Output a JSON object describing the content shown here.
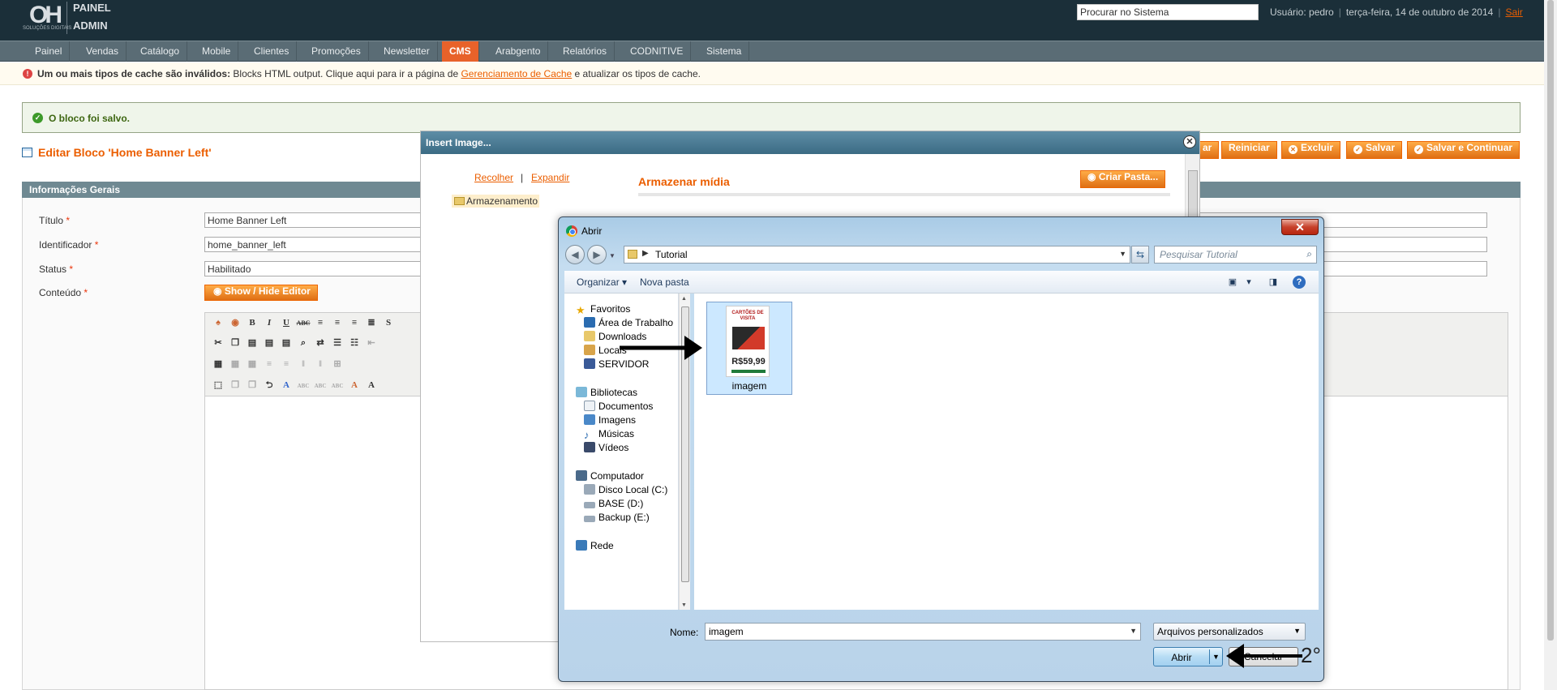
{
  "header": {
    "logo_mark": "OH",
    "logo_tagline": "SOLUÇÕES DIGITAIS",
    "logo_line1": "PAINEL",
    "logo_line2": "ADMIN",
    "search_placeholder": "Procurar no Sistema",
    "user": "Usuário: pedro",
    "date": "terça-feira, 14 de outubro de 2014",
    "logout": "Sair"
  },
  "nav": {
    "items": [
      "Painel",
      "Vendas",
      "Catálogo",
      "Mobile",
      "Clientes",
      "Promoções",
      "Newsletter",
      "CMS",
      "Arabgento",
      "Relatórios",
      "CODNITIVE",
      "Sistema"
    ],
    "active": "CMS"
  },
  "notices": {
    "cache_bold": "Um ou mais tipos de cache são inválidos:",
    "cache_text": " Blocks HTML output. Clique aqui para ir a página de ",
    "cache_link": "Gerenciamento de Cache",
    "cache_tail": " e atualizar os tipos de cache.",
    "success": "O bloco foi salvo."
  },
  "page": {
    "title": "Editar Bloco 'Home Banner Left'",
    "buttons": {
      "back": "ar",
      "reset": "Reiniciar",
      "delete": "Excluir",
      "save": "Salvar",
      "save_continue": "Salvar e Continuar"
    }
  },
  "form": {
    "section_title": "Informações Gerais",
    "title_label": "Título",
    "title_value": "Home Banner Left",
    "identifier_label": "Identificador",
    "identifier_value": "home_banner_left",
    "status_label": "Status",
    "status_value": "Habilitado",
    "content_label": "Conteúdo",
    "required_mark": "*",
    "toggle_editor": "Show / Hide Editor",
    "toolbar_partial": "S"
  },
  "insert_image": {
    "title": "Insert Image...",
    "collapse": "Recolher",
    "separator": "|",
    "expand": "Expandir",
    "tree_root": "Armazenamento",
    "media_title": "Armazenar mídia",
    "new_folder": "Criar Pasta..."
  },
  "open_dialog": {
    "title": "Abrir",
    "address": "Tutorial",
    "search_placeholder": "Pesquisar Tutorial",
    "organize": "Organizar",
    "new_folder": "Nova pasta",
    "nav_tree": [
      {
        "label": "Favoritos",
        "group": true
      },
      {
        "label": "Área de Trabalho",
        "group": false
      },
      {
        "label": "Downloads",
        "group": false
      },
      {
        "label": "Locais",
        "group": false
      },
      {
        "label": "SERVIDOR",
        "group": false
      },
      {
        "label": "Bibliotecas",
        "group": true
      },
      {
        "label": "Documentos",
        "group": false
      },
      {
        "label": "Imagens",
        "group": false
      },
      {
        "label": "Músicas",
        "group": false
      },
      {
        "label": "Vídeos",
        "group": false
      },
      {
        "label": "Computador",
        "group": true
      },
      {
        "label": "Disco Local (C:)",
        "group": false
      },
      {
        "label": "BASE (D:)",
        "group": false
      },
      {
        "label": "Backup (E:)",
        "group": false
      },
      {
        "label": "Rede",
        "group": true
      }
    ],
    "file": {
      "name": "imagem",
      "thumb_heading": "CARTÕES DE VISITA",
      "thumb_price": "R$59,99"
    },
    "name_label": "Nome:",
    "name_value": "imagem",
    "filter": "Arquivos personalizados",
    "open_button": "Abrir",
    "cancel_button": "Cancelar",
    "annotation_step": "2°"
  },
  "colors": {
    "header_bg": "#1b2f39",
    "nav_bg": "#5a6c75",
    "accent": "#eb5e00",
    "active_tab": "#e8622a",
    "section_head": "#6f8992"
  }
}
